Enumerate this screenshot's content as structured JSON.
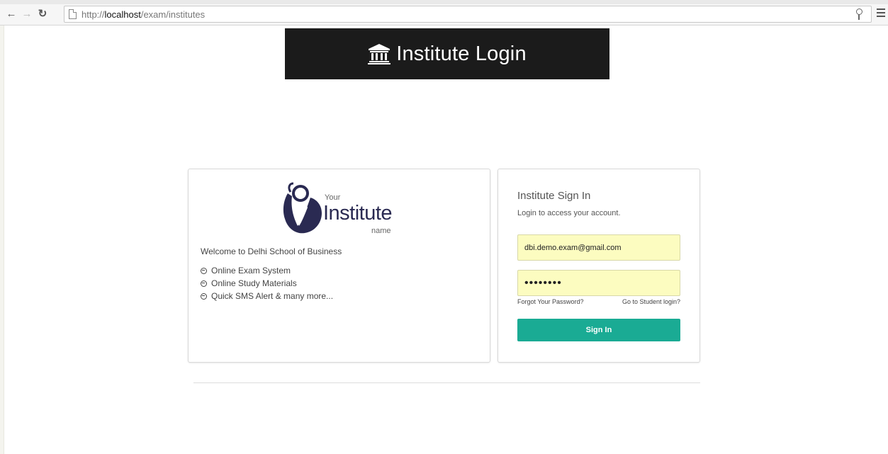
{
  "browser": {
    "url_scheme": "http://",
    "url_host": "localhost",
    "url_path": "/exam/institutes",
    "icons": [
      "back-arrow-icon",
      "forward-arrow-icon",
      "reload-icon",
      "page-icon",
      "key-icon",
      "menu-icon"
    ]
  },
  "header": {
    "title": "Institute Login",
    "icon": "institution-icon",
    "background": "#1b1b1b"
  },
  "info_panel": {
    "logo": {
      "top_text": "Your",
      "main_text": "Institute",
      "bottom_text": "name",
      "color": "#2a2a52"
    },
    "welcome": "Welcome to Delhi School of Business",
    "features": [
      "Online Exam System",
      "Online Study Materials",
      "Quick SMS Alert & many more..."
    ],
    "bullet_icon": "arrow-circle-icon"
  },
  "signin_panel": {
    "title": "Institute Sign In",
    "subtitle": "Login to access your account.",
    "email_value": "dbi.demo.exam@gmail.com",
    "password_value": "••••••••",
    "forgot_link": "Forgot Your Password?",
    "student_link": "Go to Student login?",
    "button_label": "Sign In",
    "button_color": "#1aab94",
    "autofill_color": "#fcfcc0"
  }
}
